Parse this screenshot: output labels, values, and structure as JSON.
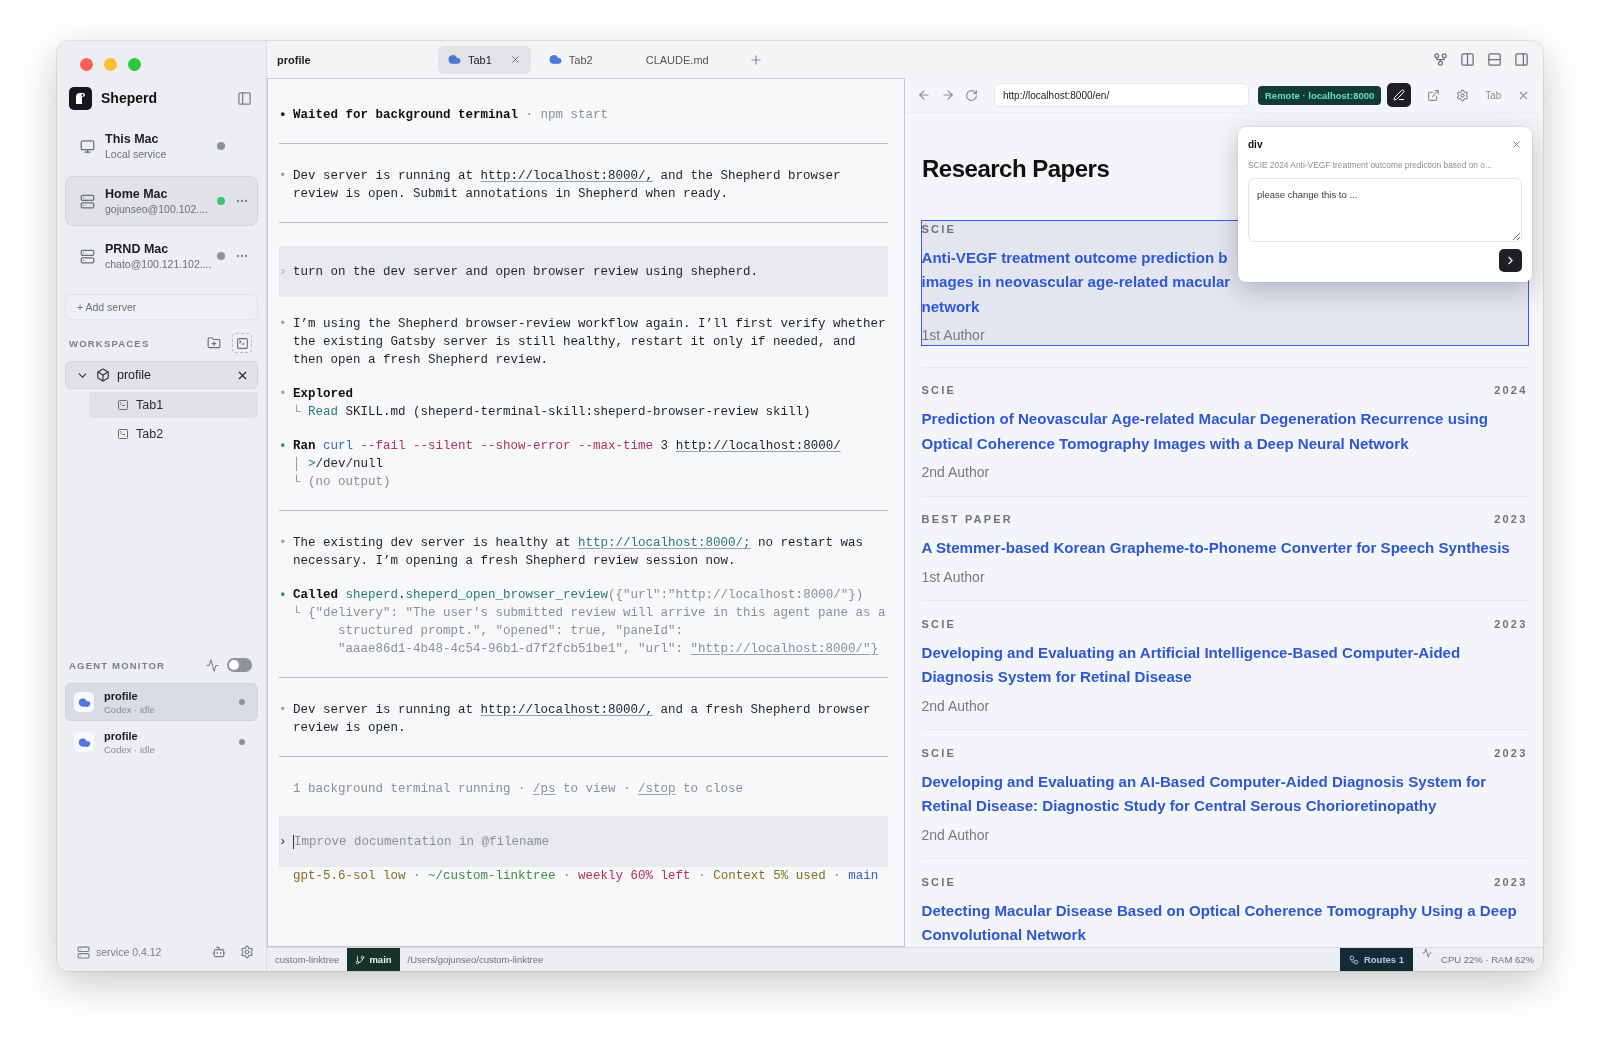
{
  "sidebar": {
    "app_name": "Sheperd",
    "servers": [
      {
        "name": "This Mac",
        "detail": "Local service",
        "kind": "local",
        "color": "#8e9196",
        "selected": false,
        "menu": false
      },
      {
        "name": "Home Mac",
        "detail": "gojunseo@100.102....",
        "kind": "remote",
        "color": "#3cc46e",
        "selected": true,
        "menu": true
      },
      {
        "name": "PRND Mac",
        "detail": "chato@100.121.102....",
        "kind": "remote",
        "color": "#8e9196",
        "selected": false,
        "menu": true
      }
    ],
    "add_server": "+ Add server",
    "workspaces_label": "WORKSPACES",
    "workspaces": [
      {
        "name": "profile",
        "expanded": true,
        "children": [
          {
            "name": "Tab1",
            "selected": true
          },
          {
            "name": "Tab2",
            "selected": false
          }
        ]
      }
    ],
    "agent_monitor_label": "AGENT MONITOR",
    "agent_monitor_on": false,
    "agents": [
      {
        "name": "profile",
        "detail": "Codex · idle",
        "selected": true
      },
      {
        "name": "profile",
        "detail": "Codex · idle",
        "selected": false
      }
    ],
    "version": "service 0.4.12"
  },
  "terminal": {
    "title": "profile",
    "tabs": [
      {
        "label": "Tab1",
        "kind": "agent",
        "selected": true
      },
      {
        "label": "Tab2",
        "kind": "agent",
        "selected": false
      },
      {
        "label": "CLAUDE.md",
        "kind": "file",
        "selected": false
      }
    ],
    "blocks": [
      {
        "kind": "message",
        "marker": {
          "text": "•",
          "kind": "bold"
        },
        "lines": [
          [
            {
              "text": "Waited for background terminal",
              "kind": "bold"
            },
            {
              "text": " · npm start",
              "kind": "dim"
            }
          ]
        ]
      },
      {
        "kind": "divider"
      },
      {
        "kind": "message",
        "marker": {
          "text": "•",
          "kind": "dim"
        },
        "lines": [
          [
            {
              "text": "Dev server is running at ",
              "kind": "plain"
            },
            {
              "text": "http://localhost:8000/,",
              "kind": "link"
            },
            {
              "text": " and the Shepherd browser",
              "kind": "plain"
            }
          ],
          [
            {
              "text": "review is open. Submit annotations in Shepherd when ready.",
              "kind": "plain"
            }
          ]
        ]
      },
      {
        "kind": "divider"
      },
      {
        "kind": "prompt",
        "marker": {
          "text": "›",
          "kind": "dim"
        },
        "lines": [
          [
            {
              "text": "turn on the dev server and open browser review using shepherd.",
              "kind": "plain"
            }
          ]
        ]
      },
      {
        "kind": "message",
        "marker": {
          "text": "•",
          "kind": "dim"
        },
        "lines": [
          [
            {
              "text": "I’m using the Shepherd browser-review workflow again. I’ll first verify whether",
              "kind": "plain"
            }
          ],
          [
            {
              "text": "the existing Gatsby server is still healthy, restart it only if needed, and",
              "kind": "plain"
            }
          ],
          [
            {
              "text": "then open a fresh Shepherd review.",
              "kind": "plain"
            }
          ]
        ]
      },
      {
        "kind": "message",
        "marker": {
          "text": "•",
          "kind": "dim"
        },
        "lines": [
          [
            {
              "text": "Explored",
              "kind": "bold"
            }
          ],
          [
            {
              "text": "└ ",
              "kind": "dim"
            },
            {
              "text": "Read",
              "kind": "teal"
            },
            {
              "text": " SKILL.md (sheperd-terminal-skill:sheperd-browser-review skill)",
              "kind": "plain"
            }
          ]
        ]
      },
      {
        "kind": "message",
        "marker": {
          "text": "•",
          "kind": "green"
        },
        "lines": [
          [
            {
              "text": "Ran",
              "kind": "bold"
            },
            {
              "text": " curl",
              "kind": "blue"
            },
            {
              "text": " --fail",
              "kind": "red"
            },
            {
              "text": " --silent",
              "kind": "red"
            },
            {
              "text": " --show-error",
              "kind": "red"
            },
            {
              "text": " --max-time",
              "kind": "red"
            },
            {
              "text": " 3 ",
              "kind": "plain"
            },
            {
              "text": "http://localhost:8000/",
              "kind": "link"
            }
          ],
          [
            {
              "text": "│ ",
              "kind": "dim"
            },
            {
              "text": ">",
              "kind": "teal"
            },
            {
              "text": "/dev/null",
              "kind": "plain"
            }
          ],
          [
            {
              "text": "└ (no output)",
              "kind": "dim"
            }
          ]
        ]
      },
      {
        "kind": "divider"
      },
      {
        "kind": "message",
        "marker": {
          "text": "•",
          "kind": "dim"
        },
        "lines": [
          [
            {
              "text": "The existing dev server is healthy at ",
              "kind": "plain"
            },
            {
              "text": "http://localhost:8000/;",
              "kind": "teallink"
            },
            {
              "text": " no restart was",
              "kind": "plain"
            }
          ],
          [
            {
              "text": "necessary. I’m opening a fresh Shepherd review session now.",
              "kind": "plain"
            }
          ]
        ]
      },
      {
        "kind": "message",
        "marker": {
          "text": "•",
          "kind": "green"
        },
        "lines": [
          [
            {
              "text": "Called",
              "kind": "bold"
            },
            {
              "text": " sheperd",
              "kind": "teal"
            },
            {
              "text": ".",
              "kind": "plain"
            },
            {
              "text": "sheperd_open_browser_review",
              "kind": "teal"
            },
            {
              "text": "({\"url\":\"http://localhost:8000/\"})",
              "kind": "dim"
            }
          ],
          [
            {
              "text": "└ {\"delivery\": \"The user's submitted review will arrive in this agent pane as a",
              "kind": "dim"
            }
          ],
          [
            {
              "text": "      structured prompt.\", \"opened\": true, \"paneId\":",
              "kind": "dim"
            }
          ],
          [
            {
              "text": "      \"aaae86d1-4b48-4c54-96b1-d7f2fcb51be1\", \"url\": ",
              "kind": "dim"
            },
            {
              "text": "\"http://localhost:8000/\"}",
              "kind": "dimlink"
            }
          ]
        ]
      },
      {
        "kind": "divider"
      },
      {
        "kind": "message",
        "marker": {
          "text": "•",
          "kind": "dim"
        },
        "lines": [
          [
            {
              "text": "Dev server is running at ",
              "kind": "plain"
            },
            {
              "text": "http://localhost:8000/,",
              "kind": "link"
            },
            {
              "text": " and a fresh Shepherd browser",
              "kind": "plain"
            }
          ],
          [
            {
              "text": "review is open.",
              "kind": "plain"
            }
          ]
        ]
      },
      {
        "kind": "divider"
      },
      {
        "kind": "note",
        "lines": [
          [
            {
              "text": "1 background terminal running · ",
              "kind": "dim"
            },
            {
              "text": "/ps",
              "kind": "dimlink"
            },
            {
              "text": " to view · ",
              "kind": "dim"
            },
            {
              "text": "/stop",
              "kind": "dimlink"
            },
            {
              "text": " to close",
              "kind": "dim"
            }
          ]
        ]
      }
    ],
    "input": {
      "marker": "›",
      "placeholder": "Improve documentation in @filename"
    },
    "status_line": [
      {
        "text": "gpt-5.6-sol low",
        "kind": "olive"
      },
      {
        "text": " · ",
        "kind": "dim"
      },
      {
        "text": "~/custom-linktree",
        "kind": "green"
      },
      {
        "text": " · ",
        "kind": "dim"
      },
      {
        "text": "weekly 60% left",
        "kind": "red"
      },
      {
        "text": " · ",
        "kind": "dim"
      },
      {
        "text": "Context 5% used",
        "kind": "olive"
      },
      {
        "text": " · ",
        "kind": "dim"
      },
      {
        "text": "main",
        "kind": "blue"
      }
    ]
  },
  "browser": {
    "toolbar": {
      "url": "http://localhost:8000/en/",
      "badge": "Remote · localhost:8000",
      "annotate_on": true,
      "tab_label": "Tab"
    },
    "heading": "Research Papers",
    "papers": [
      {
        "tag": "SCIE",
        "title": "Anti-VEGF treatment outcome prediction b\nimages in neovascular age-related macular\nnetwork",
        "role": "1st Author",
        "selected": true
      },
      {
        "tag": "SCIE",
        "year": "2024",
        "title": "Prediction of Neovascular Age-related Macular Degeneration Recurrence using Optical Coherence Tomography Images with a Deep Neural Network",
        "role": "2nd Author",
        "selected": false
      },
      {
        "tag": "BEST PAPER",
        "year": "2023",
        "title": "A Stemmer-based Korean Grapheme-to-Phoneme Converter for Speech Synthesis",
        "role": "1st Author",
        "selected": false
      },
      {
        "tag": "SCIE",
        "year": "2023",
        "title": "Developing and Evaluating an Artificial Intelligence-Based Computer-Aided Diagnosis System for Retinal Disease",
        "role": "2nd Author",
        "selected": false
      },
      {
        "tag": "SCIE",
        "year": "2023",
        "title": "Developing and Evaluating an AI-Based Computer-Aided Diagnosis System for Retinal Disease: Diagnostic Study for Central Serous Chorioretinopathy",
        "role": "2nd Author",
        "selected": false
      },
      {
        "tag": "SCIE",
        "year": "2023",
        "title": "Detecting Macular Disease Based on Optical Coherence Tomography Using a Deep Convolutional Network",
        "selected": false
      }
    ],
    "annotation": {
      "title": "div",
      "summary": "SCIE 2024 Anti-VEGF treatment outcome prediction based on o...",
      "placeholder": "please change this to ..."
    }
  },
  "status_bar": {
    "project": "custom-linktree",
    "branch": "main",
    "path": "/Users/gojunseo/custom-linktree",
    "routes": "Routes 1",
    "resources": "CPU 22% · RAM 62%"
  }
}
